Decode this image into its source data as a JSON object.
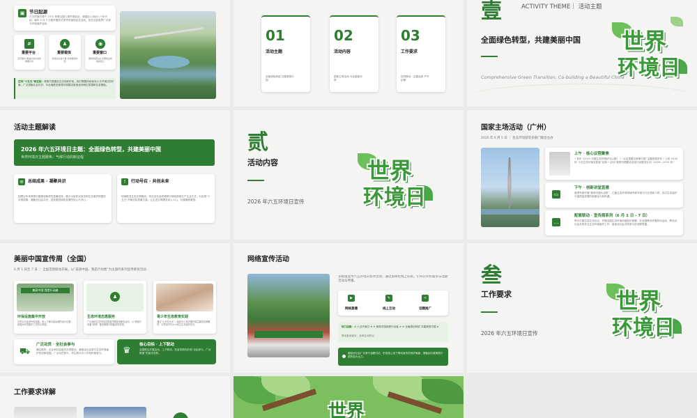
{
  "s1": {
    "title": "节日起源",
    "desc": "六五环境日源于 1972 年联合国人类环境会议，我国自上世纪八十年代起，每年 6 月 5 日都开展形式多样的宣传纪念活动，旨在引起各界广泛参与环境保护活动。",
    "cards": [
      {
        "icon": "#",
        "title": "重要平台",
        "desc": "宣传理念 推进社会共治的重要平台"
      },
      {
        "icon": "♟",
        "title": "重要载体",
        "desc": "动员全社会力量 共建美丽中国"
      },
      {
        "icon": "◉",
        "title": "重要窗口",
        "desc": "展现我国生态 文明建设成效的窗口"
      }
    ],
    "note_head": "迈向“十五五”新征程：",
    "note": "美丽中国建设正迈向新阶段，我们需要持续宣传六五环境日的价值，广泛凝聚社会共识，为全面推进美丽中国建设营造良好舆论氛围和社会基础。"
  },
  "s2": {
    "items": [
      {
        "num": "01",
        "label": "活动主题",
        "desc": "全面绿色转型 共建美丽中国"
      },
      {
        "num": "02",
        "label": "活动内容",
        "desc": "国家主场活动 与全国宣传周"
      },
      {
        "num": "03",
        "label": "工作要求",
        "desc": "协同联动 · 注重品质 严守纪律"
      }
    ]
  },
  "s3": {
    "numeral": "壹",
    "tag": "ACTIVITY THEME｜ 活动主题",
    "title": "全面绿色转型，共建美丽中国",
    "subtitle": "Comprehensive Green Transition, Co-building a Beautiful China",
    "logo1": "世界",
    "logo2": "环境日"
  },
  "s4": {
    "title": "活动主题解读",
    "banner_title": "2026 年六五环境日主题：全面绿色转型，共建美丽中国",
    "banner_sub": "世界环境日主题聚焦：气候行动的新征程",
    "c1_title": "总结成果 · 凝聚共识",
    "c1_desc": "回顾近年来美丽中国建设取得的显著成效，展示污染防治攻坚和生态保护修复的丰硕成果，凝聚全社会共识，坚定推进绿色发展的信心与决心。",
    "c2_title": "行动号召 · 共创未来",
    "c2_desc": "持续推进生态文明建设，号召全社会积极践行绿色低碳生产生活方式，为实现“十五五”开局目标贡献力量，让生态文明理念深入人心，共建美丽家园。"
  },
  "s5": {
    "numeral": "贰",
    "title": "活动内容",
    "subtitle": "2026 年六五环境日宣传",
    "logo1": "世界",
    "logo2": "环境日"
  },
  "s6": {
    "title": "国家主场活动（广州）",
    "sub": "2026 年 6 月 5 日 ｜ 生态环境部等多部门联合主办",
    "items": [
      {
        "title": "上午 · 核心议程聚焦",
        "desc": "• 发布《2025 中国生态环境状况公报》 • “从这里看见美丽中国”主题视频发布 • 公布 2026 年“十佳生态环境志愿者”名单 • 启动“美丽中国建设全民行动推进计划（2026—2030 年）”"
      },
      {
        "title": "下午 · 创新讲堂直播",
        "desc": "邀请专家开展“美丽中国大讲堂”，汇聚生态环境领域专家学者与行业领军人物，探讨生态保护与高质量发展的新路径与新机遇。"
      },
      {
        "title": "配套联动 · 宣传周系列（6 月 1 日 - 7 日）",
        "desc": "举办中国生态文化论坛、开展全国生态环境科普知识竞赛，在全国联动开展系列活动，联动全社会共同关注生态环境保护工作，营造全社会共同参与的浓厚氛围。"
      }
    ]
  },
  "s7": {
    "title": "美丽中国宣传周（全国）",
    "sub": "6 月 1 日至 7 日 ｜ 全国范围联动开展，以“美丽中国，我是行动者”为主题的系列宣传教育活动",
    "banner": "美丽中国 我是行动者",
    "cols": [
      {
        "title": "环保设施集中开放",
        "desc": "引导公众走进环保设施，深入了解污染治理的运行过程，增强对环境保护工作的认同感。"
      },
      {
        "title": "生态环境志愿服务",
        "desc": "广泛组织生态环保志愿者开展宣传服务活动，以“我是行动者”精神，推进美丽中国建设的实践。"
      },
      {
        "title": "青少年生态教育实践",
        "desc": "通过“小手拉大手”，组织青少年开展环保主题的实践教育，引导孩子们从小树立生态保护意识。"
      }
    ],
    "b1_title": "广泛动员 · 全社会参与",
    "b1_desc": "通过政府、企业和社会组织共同推动，营造全社会参与生态环境保护的浓厚氛围，广泛动员群众、学生和大中小学校积极参与。",
    "b2_title": "核心目标 · 上下联动",
    "b2_desc": "全国联合开展活动，上下联动，在宣传周内形成“全民参与、广泛覆盖”的宣传态势。"
  },
  "s8": {
    "title": "网络宣传活动",
    "intro": "多视角宣传六五环境日各项活动，通过多样化线上形式，引导公众积极参与话题活动与传播。",
    "chips": [
      {
        "icon": "▶",
        "label": "网络直播"
      },
      {
        "icon": "✎",
        "label": "线上互动"
      },
      {
        "icon": "<",
        "label": "话题推广"
      }
    ],
    "topic_head": "热门话题：",
    "topics": "# 六五环境日 # # 美丽中国我是行动者 # # 全面绿色转型 共建美丽中国 #",
    "topic_desc": "联动各地宣传，全网互动热议",
    "foot": "鼓励全社会广泛参与话题讨论，形成线上线下联动宣传的良好局面，凝聚起共建美丽中国的强大合力。"
  },
  "s9": {
    "numeral": "叁",
    "title": "工作要求",
    "subtitle": "2026 年六五环境日宣传",
    "logo1": "世界",
    "logo2": "环境日"
  },
  "s10": {
    "title": "工作要求详解"
  },
  "s11": {
    "logo1": "世界"
  },
  "colors": {
    "accent": "#2e7d32",
    "light": "#e6f2e3",
    "bg": "#f4f5f3"
  }
}
